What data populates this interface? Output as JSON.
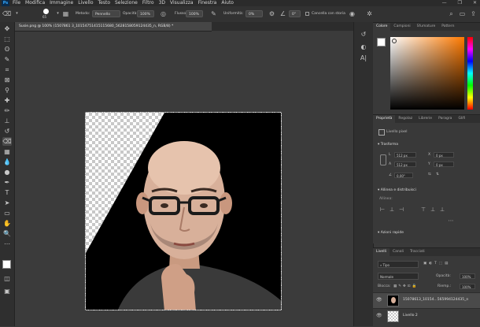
{
  "menubar": {
    "logo": "Ps",
    "items": [
      "File",
      "Modifica",
      "Immagine",
      "Livello",
      "Testo",
      "Selezione",
      "Filtro",
      "3D",
      "Visualizza",
      "Finestra",
      "Aiuto"
    ],
    "window_controls": [
      "—",
      "❐",
      "✕"
    ]
  },
  "options": {
    "brush_size": "65",
    "metodo_label": "Metodo:",
    "metodo_value": "Pennello",
    "opacita_label": "Opacità:",
    "opacita_value": "100%",
    "flusso_label": "Flusso:",
    "flusso_value": "100%",
    "uniformita_label": "Uniformità:",
    "uniformita_value": "0%",
    "angle_value": "0°",
    "cancella_label": "Cancella con storia"
  },
  "document": {
    "tab_title": "Susie.png @ 100% (1507861 3_10154751415115680_5628158059124435_n, RGB/8) *"
  },
  "colors": {
    "accent": "#31a8ff",
    "panel_bg": "#393939",
    "app_bg": "#3a3a3a"
  },
  "color_panel": {
    "tabs": [
      "Colore",
      "Campioni",
      "Sfumature",
      "Pattern"
    ]
  },
  "properties_panel": {
    "tabs": [
      "Proprietà",
      "Regolaz",
      "Librerie",
      "Paragra",
      "Glifi"
    ],
    "layer_type": "Livello pixel",
    "trasforma_title": "Trasforma",
    "L_label": "L",
    "L_value": "512 px",
    "A_label": "A",
    "A_value": "512 px",
    "X_label": "X",
    "X_value": "0 px",
    "Y_label": "Y",
    "Y_value": "0 px",
    "angle_value": "0,00°",
    "allinea_title": "Allinea e distribuisci",
    "allinea_sub": "Allinea:",
    "azioni_title": "Azioni rapide"
  },
  "layers_panel": {
    "tabs": [
      "Livelli",
      "Canali",
      "Tracciati"
    ],
    "filter_value": "Tipo",
    "blend_value": "Normale",
    "opacita_label": "Opacità:",
    "opacita_value": "100%",
    "blocca_label": "Blocca:",
    "riemp_label": "Riemp.:",
    "riemp_value": "100%",
    "layers": [
      {
        "name": "15078613_10154...565994124435_n"
      },
      {
        "name": "Livello 2"
      }
    ]
  }
}
